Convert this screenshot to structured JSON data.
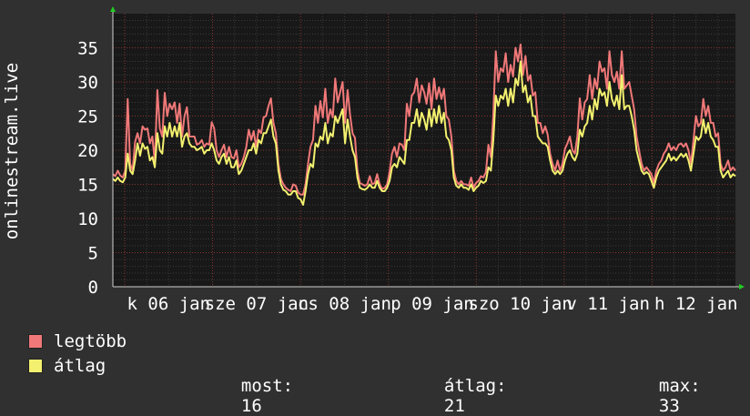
{
  "chart_data": {
    "type": "line",
    "ylabel": "onlinestream.live",
    "ylim": [
      0,
      40
    ],
    "yticks": [
      0,
      5,
      10,
      15,
      20,
      25,
      30,
      35
    ],
    "x_tick_labels": [
      "k 06 jan",
      "sze 07 jan",
      "cs 08 jan",
      "p 09 jan",
      "szo 10 jan",
      "v 11 jan",
      "h 12 jan"
    ],
    "grid": true,
    "colors": {
      "max": "#f07878",
      "avg": "#f2f06e",
      "background": "#303030",
      "plot": "#181818"
    },
    "series": [
      {
        "name": "legtöbb",
        "key": "max",
        "values": [
          16.5,
          16.2,
          17.0,
          16.3,
          16.0,
          17.0,
          27.5,
          18.0,
          17.0,
          21.2,
          22.5,
          21.0,
          23.5,
          23.0,
          23.2,
          21.0,
          22.0,
          18.2,
          28.8,
          23.2,
          22.0,
          28.4,
          25.0,
          26.8,
          26.0,
          27.0,
          24.0,
          26.8,
          22.0,
          25.0,
          26.3,
          22.0,
          22.0,
          22.0,
          20.8,
          21.0,
          21.5,
          20.5,
          21.0,
          20.8,
          24.1,
          23.2,
          20.0,
          19.0,
          20.0,
          20.8,
          19.0,
          20.5,
          19.0,
          18.8,
          20.0,
          17.5,
          18.0,
          19.0,
          20.5,
          23.0,
          21.5,
          22.8,
          20.5,
          23.0,
          22.5,
          24.8,
          25.0,
          26.5,
          27.6,
          24.0,
          22.5,
          18.0,
          15.8,
          15.0,
          14.5,
          14.2,
          14.0,
          15.0,
          14.8,
          13.8,
          13.5,
          13.5,
          15.0,
          18.0,
          20.5,
          21.5,
          26.5,
          24.0,
          27.2,
          24.8,
          29.0,
          24.0,
          26.0,
          24.8,
          30.5,
          27.0,
          28.5,
          30.0,
          24.0,
          28.8,
          25.2,
          22.5,
          21.8,
          17.0,
          15.2,
          15.0,
          14.8,
          15.0,
          16.2,
          15.0,
          15.2,
          16.5,
          15.0,
          14.3,
          14.5,
          15.0,
          16.8,
          19.5,
          20.5,
          19.0,
          21.0,
          20.8,
          20.0,
          26.8,
          25.0,
          28.0,
          28.5,
          30.5,
          27.0,
          29.5,
          28.5,
          26.8,
          29.8,
          26.0,
          30.5,
          27.5,
          29.2,
          27.5,
          29.0,
          25.0,
          24.5,
          22.0,
          17.0,
          15.5,
          15.0,
          15.5,
          15.0,
          15.0,
          14.8,
          16.0,
          14.5,
          15.2,
          15.5,
          16.2,
          16.0,
          16.8,
          20.8,
          19.0,
          25.3,
          34.5,
          30.0,
          32.0,
          31.5,
          34.2,
          30.0,
          32.5,
          30.8,
          35.0,
          33.0,
          35.5,
          31.0,
          33.8,
          30.2,
          31.0,
          28.0,
          28.5,
          24.0,
          24.0,
          22.5,
          23.5,
          22.3,
          19.5,
          18.0,
          17.0,
          18.5,
          17.0,
          18.0,
          20.2,
          21.0,
          22.0,
          20.0,
          19.5,
          22.0,
          27.6,
          24.5,
          27.0,
          27.5,
          31.0,
          27.5,
          30.5,
          29.0,
          33.0,
          31.5,
          32.0,
          29.0,
          34.5,
          31.0,
          30.0,
          31.5,
          29.0,
          34.5,
          29.0,
          29.5,
          30.0,
          28.0,
          26.0,
          22.0,
          20.0,
          18.0,
          17.0,
          17.5,
          17.0,
          16.5,
          15.2,
          17.0,
          18.0,
          18.5,
          19.5,
          20.0,
          21.0,
          20.0,
          20.5,
          20.0,
          20.8,
          21.0,
          20.5,
          21.0,
          20.0,
          18.0,
          21.5,
          25.0,
          23.5,
          24.0,
          27.5,
          25.0,
          26.5,
          24.0,
          24.0,
          22.0,
          22.5,
          18.0,
          17.0,
          17.5,
          18.5,
          17.0,
          17.5,
          17.0
        ]
      },
      {
        "name": "átlag",
        "key": "avg",
        "values": [
          15.8,
          15.5,
          16.0,
          15.5,
          15.3,
          16.0,
          19.5,
          17.0,
          16.5,
          18.5,
          21.0,
          19.2,
          21.0,
          20.2,
          20.5,
          18.5,
          19.0,
          17.5,
          22.5,
          20.0,
          19.5,
          23.5,
          22.0,
          24.0,
          22.0,
          23.5,
          22.0,
          24.0,
          20.5,
          22.0,
          22.5,
          21.0,
          20.5,
          20.5,
          20.0,
          20.2,
          20.5,
          19.5,
          20.0,
          20.0,
          21.0,
          20.0,
          18.5,
          18.0,
          19.0,
          19.5,
          18.0,
          19.0,
          17.5,
          17.5,
          18.5,
          16.5,
          17.0,
          18.0,
          19.0,
          20.0,
          20.0,
          21.0,
          19.5,
          21.5,
          21.0,
          22.5,
          22.5,
          23.5,
          24.5,
          22.0,
          21.0,
          17.0,
          15.0,
          14.2,
          14.0,
          13.5,
          13.5,
          14.0,
          14.0,
          13.0,
          12.8,
          12.0,
          14.0,
          16.5,
          18.0,
          17.5,
          21.0,
          20.5,
          22.0,
          21.5,
          24.0,
          21.0,
          22.5,
          22.0,
          25.0,
          24.0,
          25.0,
          26.0,
          21.0,
          24.5,
          22.0,
          20.0,
          19.0,
          16.0,
          14.5,
          14.3,
          14.2,
          14.5,
          15.0,
          14.5,
          14.5,
          15.5,
          14.5,
          14.0,
          14.0,
          14.5,
          15.5,
          17.5,
          18.0,
          17.5,
          19.0,
          18.5,
          18.0,
          21.5,
          21.5,
          24.0,
          24.0,
          26.0,
          23.5,
          25.5,
          24.5,
          23.0,
          26.0,
          23.5,
          26.0,
          24.0,
          26.5,
          24.0,
          25.5,
          22.0,
          21.5,
          20.0,
          16.0,
          14.8,
          14.5,
          15.0,
          14.5,
          14.5,
          14.2,
          15.0,
          14.0,
          14.5,
          14.8,
          15.5,
          15.2,
          15.5,
          17.5,
          17.0,
          21.5,
          28.0,
          26.5,
          28.0,
          27.5,
          29.0,
          26.5,
          29.0,
          27.0,
          30.5,
          29.5,
          33.0,
          28.5,
          29.5,
          27.0,
          28.0,
          25.0,
          25.0,
          22.0,
          21.5,
          21.0,
          21.0,
          20.5,
          18.5,
          17.0,
          16.5,
          17.0,
          16.5,
          17.0,
          18.5,
          19.5,
          20.0,
          19.0,
          18.5,
          19.5,
          23.0,
          22.0,
          23.5,
          24.0,
          26.5,
          24.5,
          27.5,
          26.0,
          29.0,
          28.0,
          28.5,
          26.5,
          30.0,
          27.5,
          26.5,
          28.0,
          26.0,
          31.0,
          26.0,
          26.5,
          26.5,
          25.0,
          23.0,
          20.0,
          18.5,
          17.0,
          16.5,
          16.8,
          16.5,
          15.5,
          14.5,
          16.0,
          17.0,
          17.5,
          18.0,
          18.5,
          19.5,
          18.5,
          19.0,
          18.5,
          19.0,
          19.5,
          19.0,
          19.5,
          18.5,
          17.0,
          19.5,
          22.0,
          21.5,
          22.0,
          24.5,
          22.5,
          24.0,
          22.0,
          21.5,
          20.5,
          20.5,
          17.0,
          16.0,
          16.5,
          17.0,
          16.0,
          16.5,
          16.2
        ]
      }
    ]
  },
  "legend": {
    "max_label": "legtöbb",
    "avg_label": "átlag",
    "stats": {
      "now_label": "most:",
      "now_value": "16",
      "avg_label": "átlag:",
      "avg_value": "21",
      "max_label": "max:",
      "max_value": "33"
    }
  }
}
